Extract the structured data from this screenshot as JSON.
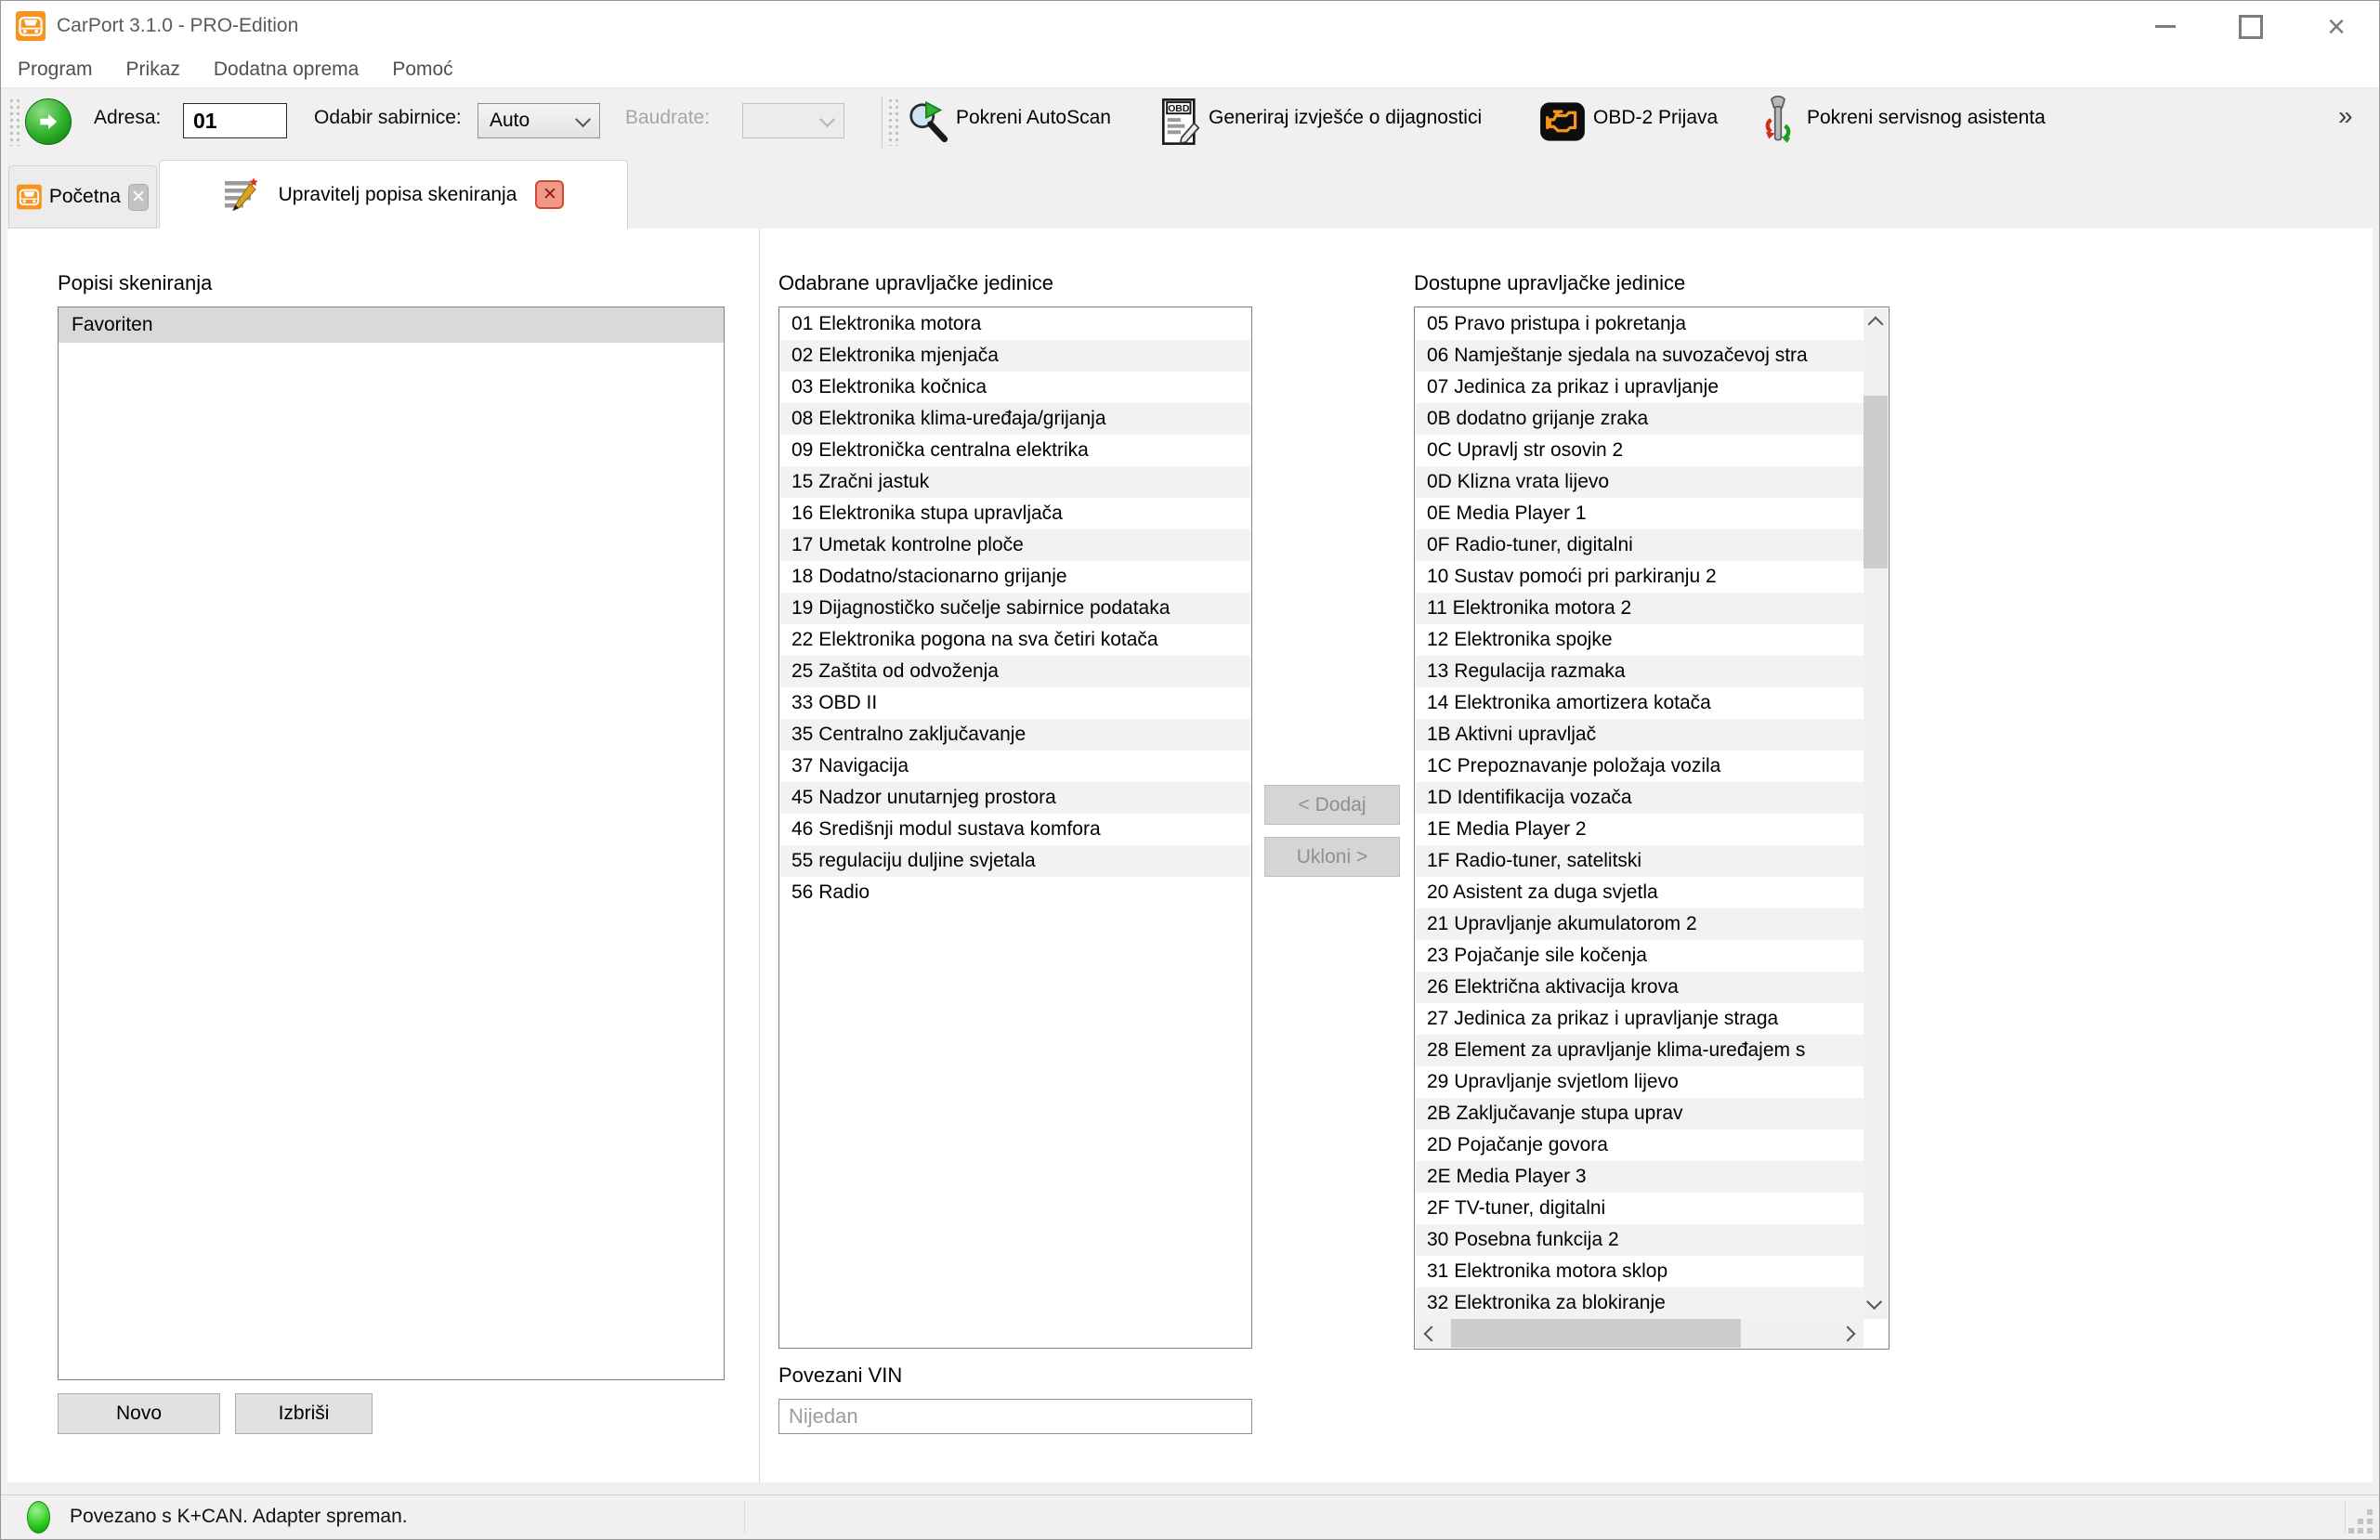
{
  "window": {
    "title": "CarPort 3.1.0 - PRO-Edition"
  },
  "menu": {
    "items": [
      "Program",
      "Prikaz",
      "Dodatna oprema",
      "Pomoć"
    ]
  },
  "toolbar": {
    "address_label": "Adresa:",
    "address_value": "01",
    "bus_label": "Odabir sabirnice:",
    "bus_value": "Auto",
    "baudrate_label": "Baudrate:",
    "autoscan_label": "Pokreni AutoScan",
    "report_label": "Generiraj izvješće o dijagnostici",
    "report_icon_text": "OBD",
    "obd_label": "OBD-2 Prijava",
    "service_label": "Pokreni servisnog asistenta",
    "overflow": "»"
  },
  "tabs": {
    "home": "Početna",
    "manager": "Upravitelj popisa skeniranja"
  },
  "left_panel": {
    "title": "Popisi skeniranja",
    "items": [
      "Favoriten"
    ],
    "new_button": "Novo",
    "delete_button": "Izbriši"
  },
  "selected_panel": {
    "title": "Odabrane upravljačke jedinice",
    "items": [
      "01 Elektronika motora",
      "02 Elektronika mjenjača",
      "03 Elektronika kočnica",
      "08 Elektronika klima-uređaja/grijanja",
      "09 Elektronička centralna elektrika",
      "15 Zračni jastuk",
      "16 Elektronika stupa upravljača",
      "17 Umetak kontrolne ploče",
      "18 Dodatno/stacionarno grijanje",
      "19 Dijagnostičko sučelje sabirnice podataka",
      "22 Elektronika pogona na sva četiri kotača",
      "25 Zaštita od odvoženja",
      "33 OBD II",
      "35 Centralno zaključavanje",
      "37 Navigacija",
      "45 Nadzor unutarnjeg prostora",
      "46 Središnji modul sustava komfora",
      "55 regulaciju duljine svjetala",
      "56 Radio"
    ]
  },
  "transfer": {
    "add": "< Dodaj",
    "remove": "Ukloni >"
  },
  "available_panel": {
    "title": "Dostupne upravljačke jedinice",
    "items": [
      "05 Pravo pristupa i pokretanja",
      "06 Namještanje sjedala na suvozačevoj stra",
      "07 Jedinica za prikaz i upravljanje",
      "0B dodatno grijanje zraka",
      "0C Upravlj str osovin 2",
      "0D Klizna vrata lijevo",
      "0E Media Player 1",
      "0F Radio-tuner, digitalni",
      "10 Sustav pomoći pri parkiranju 2",
      "11 Elektronika motora 2",
      "12 Elektronika spojke",
      "13 Regulacija razmaka",
      "14 Elektronika amortizera kotača",
      "1B Aktivni upravljač",
      "1C Prepoznavanje položaja vozila",
      "1D Identifikacija vozača",
      "1E Media Player 2",
      "1F Radio-tuner, satelitski",
      "20 Asistent za duga svjetla",
      "21 Upravljanje akumulatorom 2",
      "23 Pojačanje sile kočenja",
      "26 Električna aktivacija krova",
      "27 Jedinica za prikaz i upravljanje straga",
      "28 Element za upravljanje klima-uređajem s",
      "29 Upravljanje svjetlom lijevo",
      "2B Zaključavanje stupa uprav",
      "2D Pojačanje govora",
      "2E Media Player 3",
      "2F TV-tuner, digitalni",
      "30 Posebna funkcija 2",
      "31 Elektronika motora sklop",
      "32 Elektronika za blokiranje"
    ]
  },
  "vin": {
    "label": "Povezani VIN",
    "value": "Nijedan"
  },
  "status": {
    "text": "Povezano s K+CAN. Adapter spreman."
  },
  "colors": {
    "accent_orange": "#F7941D",
    "status_green": "#2FCE24",
    "selection_gray": "#D9D9D9"
  }
}
